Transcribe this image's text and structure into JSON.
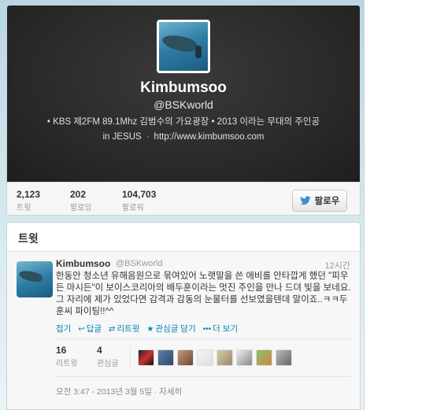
{
  "profile": {
    "name": "Kimbumsoo",
    "handle": "@BSKworld",
    "bio": "• KBS 제2FM 89.1Mhz 김범수의 가요광장 • 2013 이라는 무대의 주인공",
    "location": "in JESUS",
    "separator": "·",
    "website": "http://www.kimbumsoo.com"
  },
  "stats": {
    "tweets_count": "2,123",
    "tweets_label": "트윗",
    "following_count": "202",
    "following_label": "팔로잉",
    "followers_count": "104,703",
    "followers_label": "팔로워"
  },
  "follow_button": {
    "label": "팔로우",
    "icon": "bird-icon"
  },
  "tweets_section": {
    "title": "트윗"
  },
  "tweet": {
    "name": "Kimbumsoo",
    "handle": "@BSKworld",
    "time": "12시간",
    "text": "한동안 청소년 유해음원으로 묶여있어 노랫말을 쓴 애비를 안타깝게 했던 \"피우든 마시든\"이 보이스코리아의 배두훈이라는 멋진 주인을 만나 드뎌 빛을 보네요. 그 자리에 제가 있었다면 감격과 감동의 눈물터를 선보였을텐데 말이죠..ㅋㅋ두훈씨 파이팅!!^^",
    "actions": {
      "collapse": "접기",
      "reply": "답글",
      "retweet": "리트윗",
      "favorite": "관심글 담기",
      "more": "더 보기"
    },
    "retweets_count": "16",
    "retweets_label": "리트윗",
    "favorites_count": "4",
    "favorites_label": "관심글",
    "date": "오전 3:47 - 2013년 3월 5일 · 자세히"
  },
  "colors": {
    "link": "#0084b4",
    "header_bg": "#272727",
    "page_bg": "#c9e0ea"
  }
}
